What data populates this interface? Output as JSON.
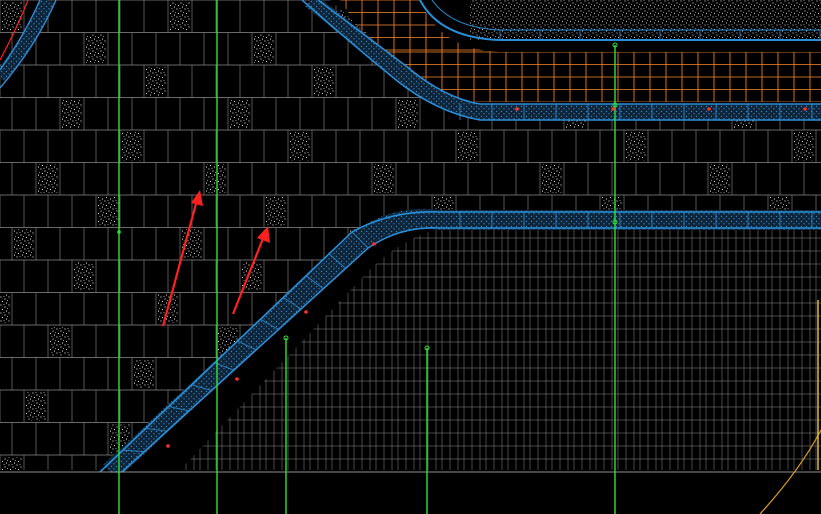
{
  "view": {
    "background": "#000000",
    "colors": {
      "grid_line": "#8c8c8c",
      "hatch": "#cfcfcf",
      "curb_edge": "#2a8fd8",
      "curb_fill": "#1f4f78",
      "orange_grid": "#ff8a2a",
      "orange_line": "#ff7a1a",
      "guide_line": "#33e033",
      "arrow": "#ff2020",
      "red_marker": "#ff3030",
      "yellow_curve": "#e0a020",
      "red_curve": "#ff2020"
    },
    "icons": [
      "arrow-annotation-icon",
      "arrow-annotation-icon"
    ]
  }
}
